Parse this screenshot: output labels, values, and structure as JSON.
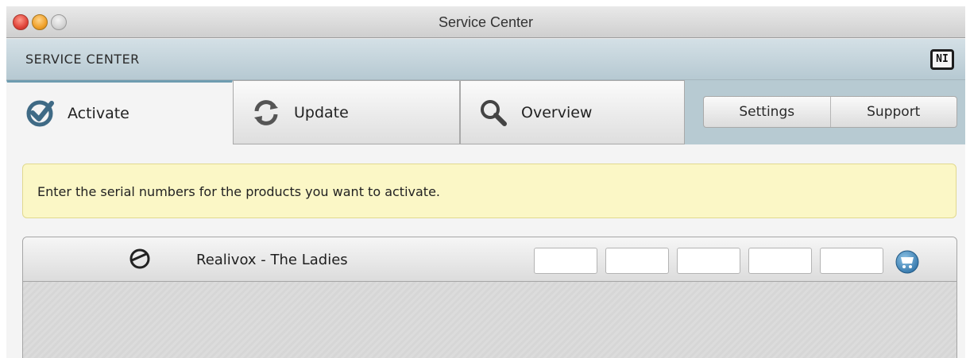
{
  "window": {
    "title": "Service Center"
  },
  "header": {
    "title": "SERVICE CENTER",
    "logo_text": "NI"
  },
  "tabs": [
    {
      "label": "Activate",
      "icon": "check-badge-icon",
      "active": true
    },
    {
      "label": "Update",
      "icon": "refresh-icon",
      "active": false
    },
    {
      "label": "Overview",
      "icon": "magnifier-icon",
      "active": false
    }
  ],
  "segments": {
    "settings": "Settings",
    "support": "Support"
  },
  "notice": {
    "text": "Enter the serial numbers for the products you want to activate."
  },
  "product": {
    "name": "Realivox - The Ladies",
    "icon": "dial-icon",
    "serial_fields": [
      "",
      "",
      "",
      "",
      ""
    ],
    "cart_icon": "cart-icon"
  },
  "colors": {
    "accent": "#6e9cb0",
    "notice_bg": "#fbf7c6",
    "header_bg": "#c4d4dc"
  }
}
